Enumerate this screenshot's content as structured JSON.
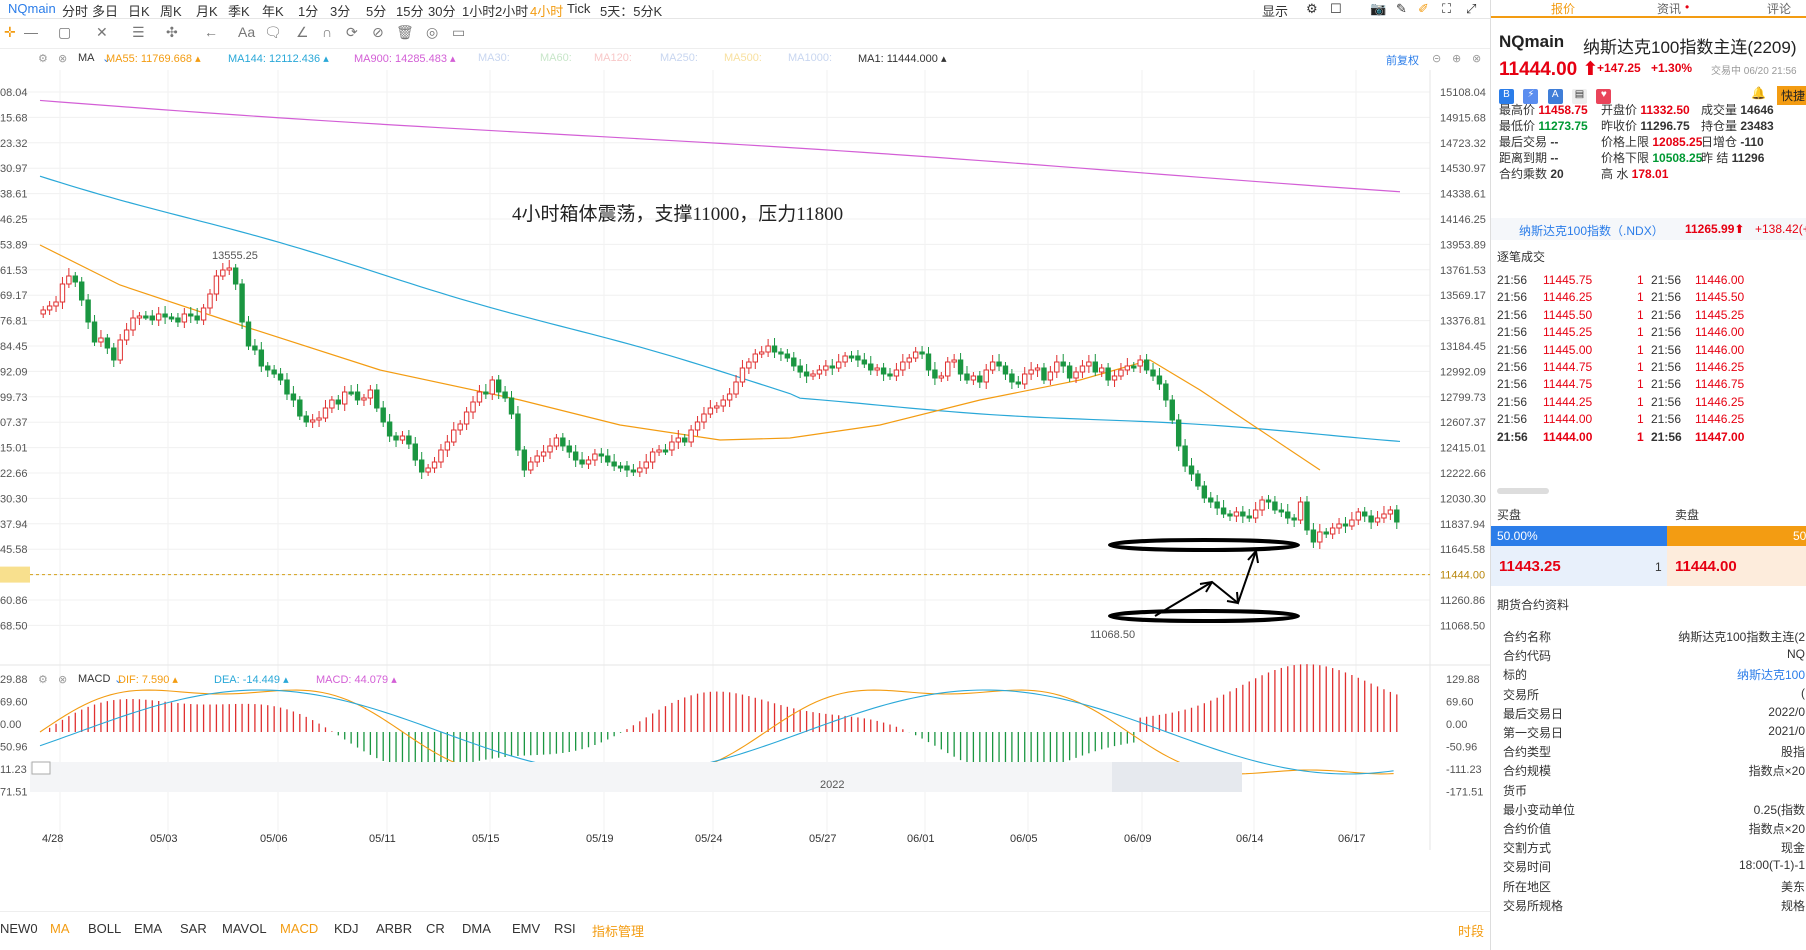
{
  "toolbar": {
    "symbol": "NQmain",
    "periods": [
      "分时",
      "多日",
      "日K",
      "周K",
      "月K",
      "季K",
      "年K",
      "1分",
      "3分",
      "5分",
      "15分",
      "30分",
      "1小时",
      "2小时",
      "4小时",
      "Tick",
      "5天：5分K"
    ],
    "active_period": "4小时",
    "display_label": "显示"
  },
  "ma_bar": {
    "type": "MA",
    "items": [
      {
        "text": "MA55: 11769.668",
        "color": "#f39c12"
      },
      {
        "text": "MA144: 12112.436",
        "color": "#2aa8d8"
      },
      {
        "text": "MA900: 14285.483",
        "color": "#d35fd6"
      },
      {
        "text": "MA30:",
        "color": "#c8d6f0"
      },
      {
        "text": "MA60:",
        "color": "#c8e6c9"
      },
      {
        "text": "MA120:",
        "color": "#f8c8c8"
      },
      {
        "text": "MA250:",
        "color": "#c8d6f0"
      },
      {
        "text": "MA500:",
        "color": "#f8e0a0"
      },
      {
        "text": "MA1000:",
        "color": "#c8d6f0"
      },
      {
        "text": "MA1: 11444.000",
        "color": "#333333"
      }
    ],
    "adjust_label": "前复权"
  },
  "annotation": "4小时箱体震荡，支撑11000，压力11800",
  "price_axis": {
    "right_labels": [
      "15108.04",
      "14915.68",
      "14723.32",
      "14530.97",
      "14338.61",
      "14146.25",
      "13953.89",
      "13761.53",
      "13569.17",
      "13376.81",
      "13184.45",
      "12992.09",
      "12799.73",
      "12607.37",
      "12415.01",
      "12222.66",
      "12030.30",
      "11837.94",
      "11645.58",
      "11444.00",
      "11260.86",
      "11068.50"
    ],
    "left_labels": [
      "08.04",
      "15.68",
      "23.32",
      "30.97",
      "38.61",
      "46.25",
      "53.89",
      "61.53",
      "69.17",
      "76.81",
      "84.45",
      "92.09",
      "99.73",
      "07.37",
      "15.01",
      "22.66",
      "30.30",
      "37.94",
      "45.58",
      "44.00",
      "60.86",
      "68.50"
    ],
    "high_mark": "13555.25",
    "low_mark": "11068.50"
  },
  "macd_bar": {
    "type": "MACD",
    "items": [
      {
        "text": "DIF: 7.590",
        "color": "#f39c12"
      },
      {
        "text": "DEA: -14.449",
        "color": "#2aa8d8"
      },
      {
        "text": "MACD: 44.079",
        "color": "#d35fd6"
      }
    ],
    "right_labels": [
      "129.88",
      "69.60",
      "0.00",
      "-50.96",
      "-111.23",
      "-171.51"
    ],
    "left_labels": [
      "29.88",
      "69.60",
      "0.00",
      "50.96",
      "11.23",
      "71.51"
    ]
  },
  "dates": [
    "4/28",
    "05/03",
    "05/06",
    "05/11",
    "05/15",
    "05/19",
    "05/24",
    "05/27",
    "06/01",
    "06/05",
    "06/09",
    "06/14",
    "06/17"
  ],
  "year": "2022",
  "indicators": [
    "NEW0",
    "MA",
    "BOLL",
    "EMA",
    "SAR",
    "MAVOL",
    "MACD",
    "KDJ",
    "ARBR",
    "CR",
    "DMA",
    "EMV",
    "RSI",
    "指标管理"
  ],
  "active_indicators": [
    "MA",
    "MACD",
    "指标管理"
  ],
  "indicator_right": "时段",
  "right_panel": {
    "tabs": [
      "报价",
      "资讯",
      "评论"
    ],
    "code": "NQmain",
    "name": "纳斯达克100指数主连(2209)",
    "price": "11444.00",
    "change": "+147.25",
    "change_pct": "+1.30%",
    "status": "交易中 06/20 21:56",
    "quick": "快捷",
    "stats": [
      [
        {
          "k": "最高价",
          "v": "11458.75",
          "c": "red"
        },
        {
          "k": "开盘价",
          "v": "11332.50",
          "c": "red"
        },
        {
          "k": "成交量",
          "v": "14646",
          "c": "plain"
        }
      ],
      [
        {
          "k": "最低价",
          "v": "11273.75",
          "c": "green"
        },
        {
          "k": "昨收价",
          "v": "11296.75",
          "c": "plain"
        },
        {
          "k": "持仓量",
          "v": "23483",
          "c": "plain"
        }
      ],
      [
        {
          "k": "最后交易",
          "v": "--",
          "c": "plain"
        },
        {
          "k": "价格上限",
          "v": "12085.25",
          "c": "red"
        },
        {
          "k": "日增仓",
          "v": "-110",
          "c": "plain"
        }
      ],
      [
        {
          "k": "距离到期",
          "v": "--",
          "c": "plain"
        },
        {
          "k": "价格下限",
          "v": "10508.25",
          "c": "green"
        },
        {
          "k": "昨  结",
          "v": "11296",
          "c": "plain"
        }
      ],
      [
        {
          "k": "合约乘数",
          "v": "20",
          "c": "plain"
        },
        {
          "k": "高  水",
          "v": "178.01",
          "c": "red"
        },
        {
          "k": "",
          "v": "",
          "c": "plain"
        }
      ]
    ],
    "index_name": "纳斯达克100指数（.NDX）",
    "index_price": "11265.99",
    "index_change": "+138.42(+1.2",
    "ticks_title": "逐笔成交",
    "ticks": [
      {
        "t1": "21:56",
        "p1": "11445.75",
        "v1": "1",
        "t2": "21:56",
        "p2": "11446.00"
      },
      {
        "t1": "21:56",
        "p1": "11446.25",
        "v1": "1",
        "t2": "21:56",
        "p2": "11445.50"
      },
      {
        "t1": "21:56",
        "p1": "11445.50",
        "v1": "1",
        "t2": "21:56",
        "p2": "11445.25"
      },
      {
        "t1": "21:56",
        "p1": "11445.25",
        "v1": "1",
        "t2": "21:56",
        "p2": "11446.00"
      },
      {
        "t1": "21:56",
        "p1": "11445.00",
        "v1": "1",
        "t2": "21:56",
        "p2": "11446.00"
      },
      {
        "t1": "21:56",
        "p1": "11444.75",
        "v1": "1",
        "t2": "21:56",
        "p2": "11446.25"
      },
      {
        "t1": "21:56",
        "p1": "11444.75",
        "v1": "1",
        "t2": "21:56",
        "p2": "11446.75"
      },
      {
        "t1": "21:56",
        "p1": "11444.25",
        "v1": "1",
        "t2": "21:56",
        "p2": "11446.25"
      },
      {
        "t1": "21:56",
        "p1": "11444.00",
        "v1": "1",
        "t2": "21:56",
        "p2": "11446.25"
      },
      {
        "t1": "21:56",
        "p1": "11444.00",
        "v1": "1",
        "t2": "21:56",
        "p2": "11447.00"
      }
    ],
    "buy_label": "买盘",
    "sell_label": "卖盘",
    "buy_pct": "50.00%",
    "sell_pct": "50",
    "bid_price": "11443.25",
    "bid_vol": "1",
    "ask_price": "11444.00",
    "spec_title": "期货合约资料",
    "spec": [
      {
        "k": "合约名称",
        "v": "纳斯达克100指数主连(2"
      },
      {
        "k": "合约代码",
        "v": "NQ"
      },
      {
        "k": "标的",
        "v": "纳斯达克100"
      },
      {
        "k": "交易所",
        "v": "("
      },
      {
        "k": "最后交易日",
        "v": "2022/0"
      },
      {
        "k": "第一交易日",
        "v": "2021/0"
      },
      {
        "k": "合约类型",
        "v": "股指"
      },
      {
        "k": "合约规模",
        "v": "指数点×20"
      },
      {
        "k": "货币",
        "v": ""
      },
      {
        "k": "最小变动单位",
        "v": "0.25(指数"
      },
      {
        "k": "合约价值",
        "v": "指数点×20"
      },
      {
        "k": "交割方式",
        "v": "现金"
      },
      {
        "k": "交易时间",
        "v": "18:00(T-1)-1"
      },
      {
        "k": "所在地区",
        "v": "美东"
      },
      {
        "k": "交易所规格",
        "v": "规格"
      }
    ]
  },
  "colors": {
    "up": "#e03030",
    "down": "#1a9641",
    "ma55": "#f39c12",
    "ma144": "#2aa8d8",
    "ma900": "#d35fd6",
    "accent": "#f39c12"
  }
}
